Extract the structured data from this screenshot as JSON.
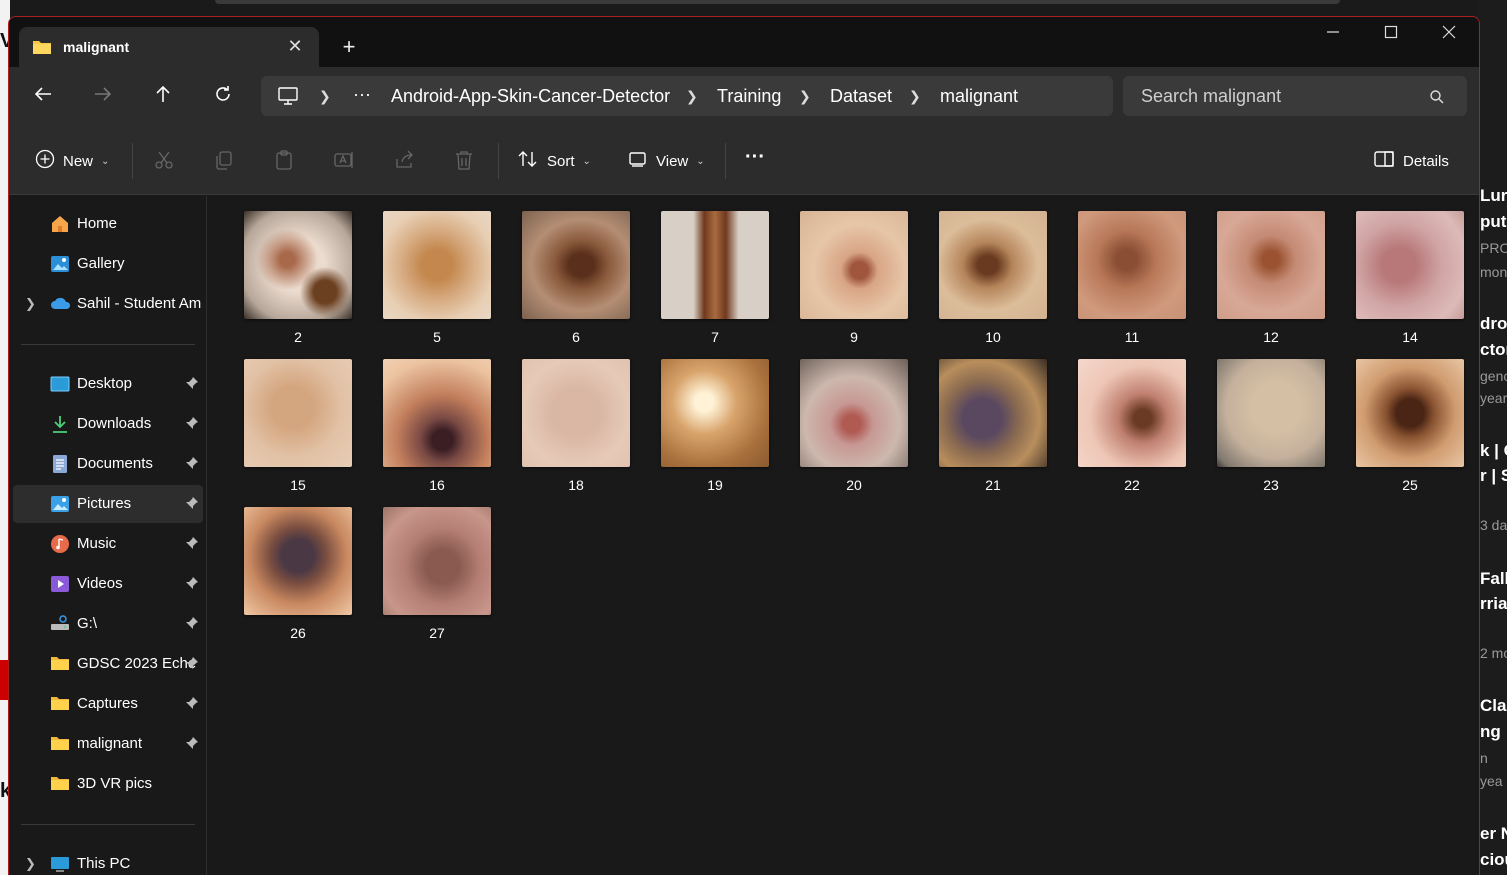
{
  "tab": {
    "title": "malignant",
    "close": "✕",
    "new": "+"
  },
  "window_controls": {
    "minimize": "—",
    "maximize": "☐",
    "close": "✕"
  },
  "address": {
    "more": "···",
    "crumbs": [
      "Android-App-Skin-Cancer-Detector",
      "Training",
      "Dataset",
      "malignant"
    ]
  },
  "search": {
    "placeholder": "Search malignant"
  },
  "toolbar": {
    "new_label": "New",
    "sort_label": "Sort",
    "view_label": "View",
    "more_label": "···",
    "details_label": "Details"
  },
  "sidebar": {
    "items": [
      {
        "label": "Home",
        "icon": "home-icon",
        "pinned": false
      },
      {
        "label": "Gallery",
        "icon": "gallery-icon",
        "pinned": false
      },
      {
        "label": "Sahil - Student Aml",
        "icon": "onedrive-icon",
        "pinned": false,
        "expandable": true
      },
      {
        "label": "Desktop",
        "icon": "desktop-icon",
        "pinned": true
      },
      {
        "label": "Downloads",
        "icon": "downloads-icon",
        "pinned": true
      },
      {
        "label": "Documents",
        "icon": "documents-icon",
        "pinned": true
      },
      {
        "label": "Pictures",
        "icon": "pictures-icon",
        "pinned": true,
        "selected": true
      },
      {
        "label": "Music",
        "icon": "music-icon",
        "pinned": true
      },
      {
        "label": "Videos",
        "icon": "videos-icon",
        "pinned": true
      },
      {
        "label": "G:\\",
        "icon": "network-drive-icon",
        "pinned": true
      },
      {
        "label": "GDSC 2023 Eche",
        "icon": "folder-icon",
        "pinned": true
      },
      {
        "label": "Captures",
        "icon": "folder-icon",
        "pinned": true
      },
      {
        "label": "malignant",
        "icon": "folder-icon",
        "pinned": true
      },
      {
        "label": "3D VR pics",
        "icon": "folder-icon",
        "pinned": false
      },
      {
        "label": "This PC",
        "icon": "this-pc-icon",
        "pinned": false,
        "expandable": true
      }
    ]
  },
  "files": [
    "2",
    "5",
    "6",
    "7",
    "9",
    "10",
    "11",
    "12",
    "14",
    "15",
    "16",
    "18",
    "19",
    "20",
    "21",
    "22",
    "23",
    "25",
    "26",
    "27"
  ],
  "background": {
    "right_fragments": [
      "Lur",
      "putr",
      "PRO",
      "mon",
      "droi",
      "ctor",
      "genc",
      "year",
      "k | C",
      "r | S",
      "3 da",
      "Falli",
      "rria",
      "2 mo",
      "Cla",
      "ng",
      "n",
      "yea",
      "er N",
      "ciou"
    ],
    "left_fragments": [
      "V",
      "k"
    ]
  },
  "colors": {
    "accent": "#4cc2ff",
    "folder": "#f8c746",
    "border": "#a82020"
  }
}
